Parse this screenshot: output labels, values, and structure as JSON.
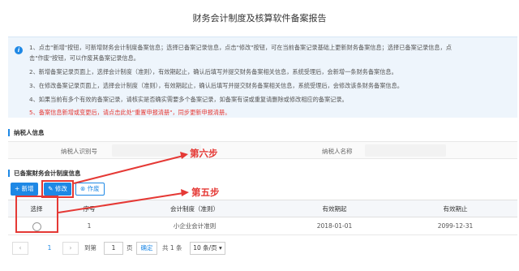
{
  "page": {
    "title": "财务会计制度及核算软件备案报告"
  },
  "notice": {
    "lines": [
      "1、点击\"新增\"按钮，可新增财务会计制度备案信息；选择已备案记录信息，点击\"修改\"按钮，可在当前备案记录基础上更新财务备案信息；选择已备案记录信息，点",
      "击\"作废\"按钮，可以作废其备案记录信息。",
      "2、新增备案记录页面上，选择会计制度（准则），有效期起止，确认后填写并提交财务备案相关信息，系统受理后，会新增一条财务备案信息。",
      "3、在修改备案记录页面上，选择会计制度（准则），有效期起止，确认后填写并提交财务备案相关信息，系统受理后，会修改该条财务备案信息。",
      "4、如果当前有多个有效的备案记录，请核实是否确实需要多个备案记录，如备案有误或重复请删除或修改相应的备案记录。",
      "5、备案信息新增或变更后，请点击此处\"重置申报清册\"，同步更新申报清册。"
    ]
  },
  "taxpayer": {
    "section_title": "纳税人信息",
    "id_label": "纳税人识别号",
    "name_label": "纳税人名称"
  },
  "records": {
    "section_title": "已备案财务会计制度信息",
    "add_label": "+ 新增",
    "edit_label": "✎ 修改",
    "void_label": "⊗ 作废",
    "columns": [
      "选择",
      "序号",
      "会计制度（准则）",
      "有效期起",
      "有效期止"
    ],
    "rows": [
      {
        "seq": "1",
        "standard": "小企业会计准则",
        "start": "2018-01-01",
        "end": "2099-12-31"
      }
    ]
  },
  "annotations": {
    "step6": "第六步",
    "step5": "第五步"
  },
  "pagination": {
    "prev": "‹",
    "current": "1",
    "next": "›",
    "goto_label": "到第",
    "goto_value": "1",
    "page_unit": "页",
    "confirm": "确定",
    "total": "共 1 条",
    "page_size": "10 条/页 ▾"
  },
  "colors": {
    "accent": "#1e88e5",
    "annotation": "#e53935"
  }
}
